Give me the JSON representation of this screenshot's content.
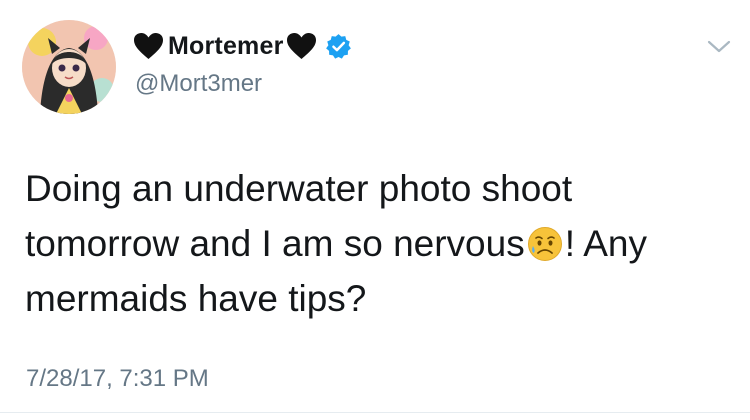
{
  "tweet": {
    "display_name": "Mortemer",
    "handle": "@Mort3mer",
    "text_before_emoji": "Doing an underwater photo shoot tomorrow and I am so nervous",
    "text_after_emoji": "! Any mermaids have tips?",
    "timestamp": "7/28/17, 7:31 PM",
    "emoji": "sad-relieved-face-icon",
    "verified": true
  },
  "icons": {
    "left_heart": "black-heart-icon",
    "right_heart": "black-heart-icon",
    "verified": "verified-badge-icon",
    "menu": "chevron-down-icon",
    "avatar": "avatar"
  },
  "colors": {
    "text": "#14171a",
    "secondary_text": "#657786",
    "verified_blue": "#1da1f2",
    "chevron": "#aab8c2"
  }
}
